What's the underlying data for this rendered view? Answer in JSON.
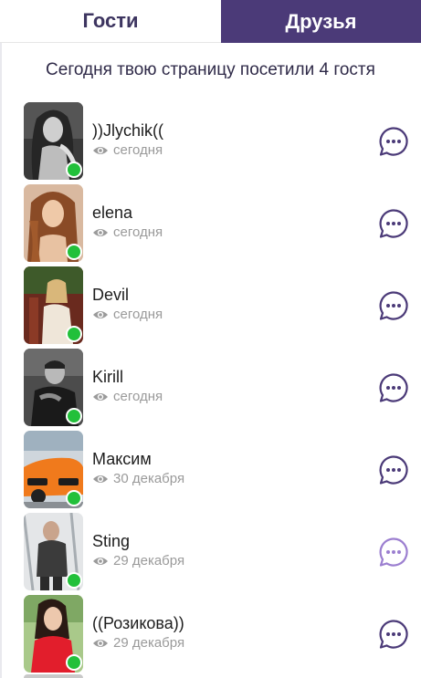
{
  "tabs": {
    "guests": "Гости",
    "friends": "Друзья"
  },
  "headline": "Сегодня твою страницу посетили 4 гостя",
  "colors": {
    "accent": "#4b3a78",
    "online": "#22c03a",
    "muted": "#9a9a9a"
  },
  "icons": {
    "visit": "eye-icon",
    "chat": "chat-bubble-icon",
    "status": "online-dot"
  },
  "visitors": [
    {
      "name": "))Jlychik((",
      "when": "сегодня"
    },
    {
      "name": "elena",
      "when": "сегодня"
    },
    {
      "name": "Devil",
      "when": "сегодня"
    },
    {
      "name": "Kirill",
      "when": "сегодня"
    },
    {
      "name": "Максим",
      "when": "30 декабря"
    },
    {
      "name": "Sting",
      "when": "29 декабря"
    },
    {
      "name": "((Розикова))",
      "when": "29 декабря"
    }
  ]
}
